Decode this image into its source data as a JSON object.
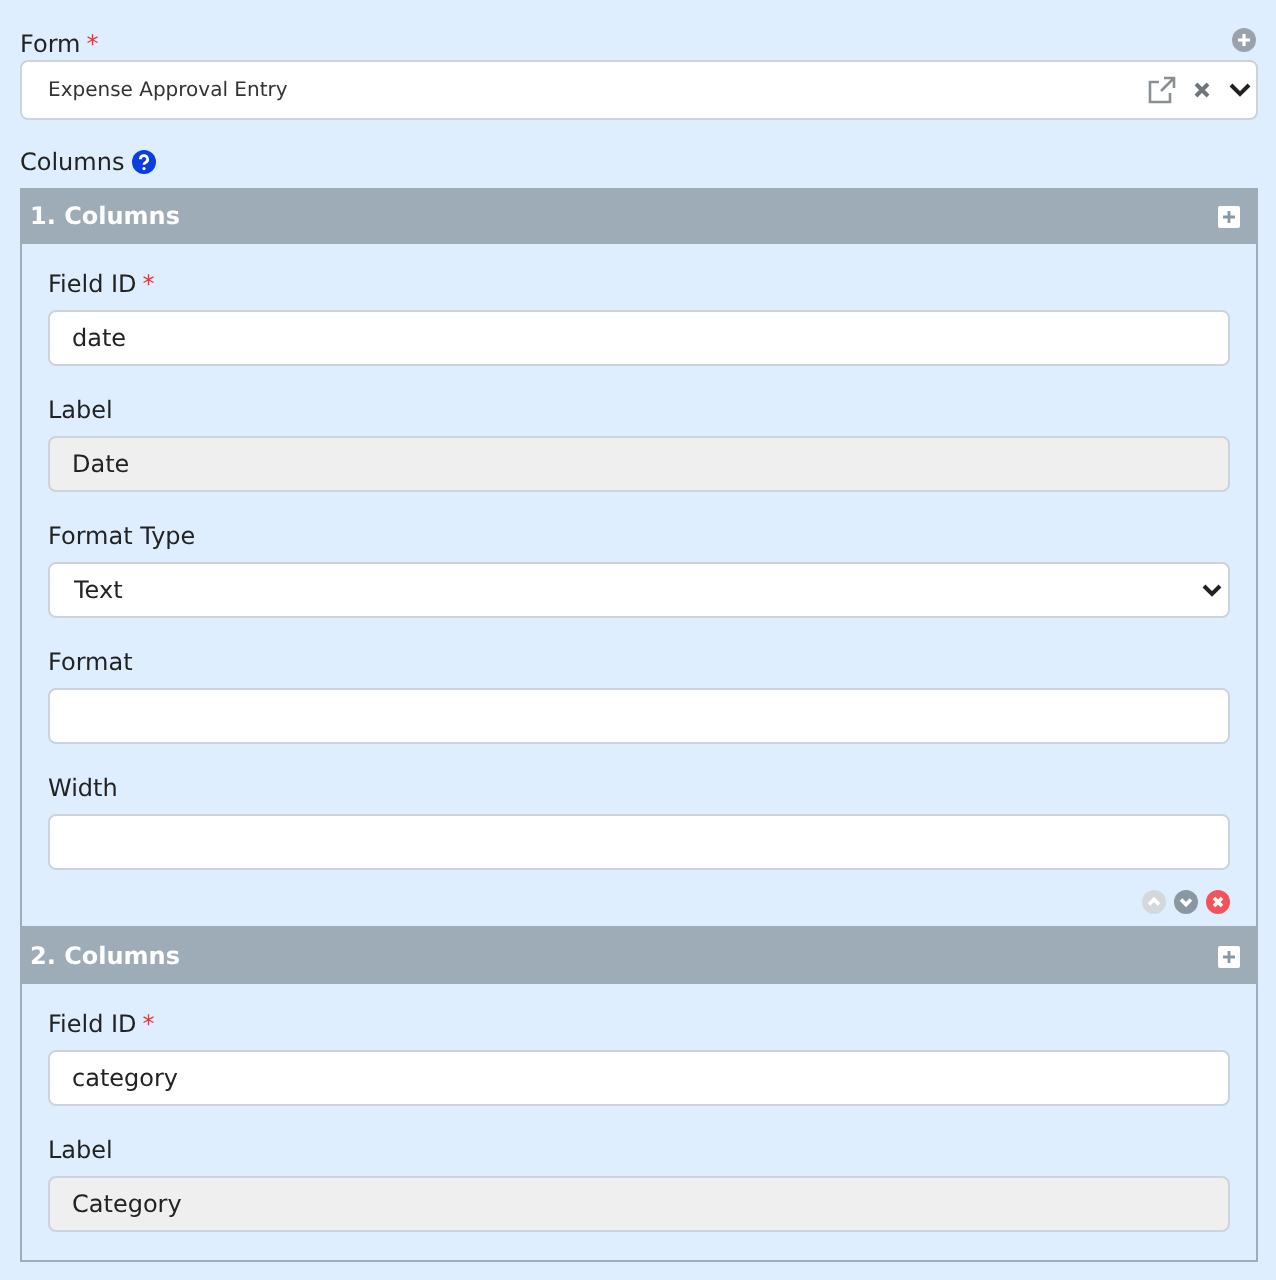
{
  "form": {
    "label": "Form",
    "required_mark": "*",
    "value": "Expense Approval Entry"
  },
  "columns": {
    "label": "Columns",
    "panels": [
      {
        "title": "1. Columns",
        "fields": [
          {
            "label": "Field ID",
            "required_mark": "*",
            "kind": "input",
            "value": "date",
            "readonly": false
          },
          {
            "label": "Label",
            "kind": "input",
            "value": "Date",
            "readonly": true
          },
          {
            "label": "Format Type",
            "kind": "select",
            "value": "Text",
            "readonly": false
          },
          {
            "label": "Format",
            "kind": "input",
            "readonly": false
          },
          {
            "label": "Width",
            "kind": "input",
            "readonly": false
          }
        ],
        "move_up_disabled": true,
        "move_down_disabled": false
      },
      {
        "title": "2. Columns",
        "fields": [
          {
            "label": "Field ID",
            "required_mark": "*",
            "kind": "input",
            "value": "category",
            "readonly": false
          },
          {
            "label": "Label",
            "kind": "input",
            "value": "Category",
            "readonly": true
          }
        ]
      }
    ]
  }
}
